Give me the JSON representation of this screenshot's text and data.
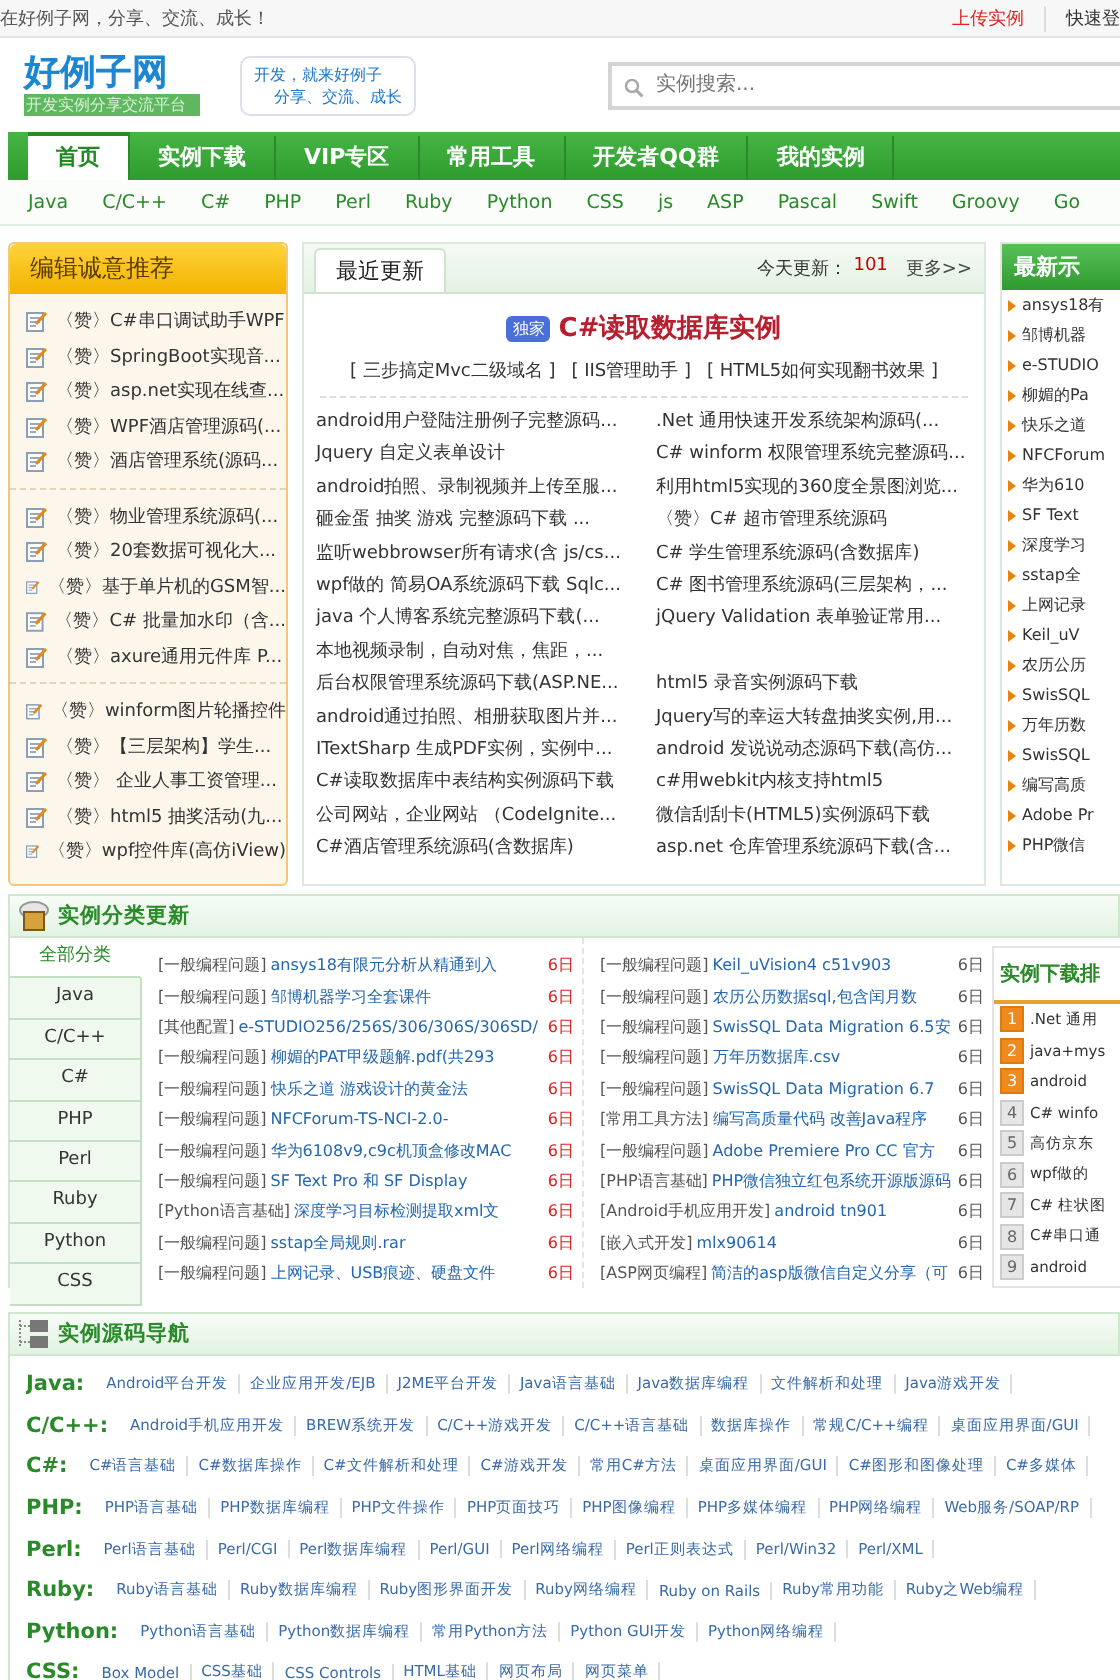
{
  "top_bar": {
    "greeting": "在好例子网，分享、交流、成长！",
    "links": [
      "上传实例",
      "快速登"
    ]
  },
  "header": {
    "logo": "好例子网",
    "logo_sub": "开发实例分享交流平台",
    "slogan": [
      "开发，就来好例子",
      "分享、交流、成长"
    ],
    "search": {
      "placeholder": "实例搜索..."
    }
  },
  "nav": [
    {
      "label": "首页",
      "selected": true
    },
    {
      "label": "实例下载",
      "selected": false
    },
    {
      "label": "VIP专区",
      "selected": false
    },
    {
      "label": "常用工具",
      "selected": false
    },
    {
      "label": "开发者QQ群",
      "selected": false
    },
    {
      "label": "我的实例",
      "selected": false
    }
  ],
  "languages": [
    "Java",
    "C/C++",
    "C#",
    "PHP",
    "Perl",
    "Ruby",
    "Python",
    "CSS",
    "js",
    "ASP",
    "Pascal",
    "Swift",
    "Groovy",
    "Go"
  ],
  "editor_picks": {
    "title": "编辑诚意推荐",
    "groups": [
      [
        "〈赞〉C#串口调试助手WPF",
        "〈赞〉SpringBoot实现音...",
        "〈赞〉asp.net实现在线查...",
        "〈赞〉WPF酒店管理源码(...",
        "〈赞〉酒店管理系统(源码..."
      ],
      [
        "〈赞〉物业管理系统源码(...",
        "〈赞〉20套数据可视化大...",
        "〈赞〉基于单片机的GSM智...",
        "〈赞〉C# 批量加水印（含...",
        "〈赞〉axure通用元件库 P..."
      ],
      [
        "〈赞〉winform图片轮播控件",
        "〈赞〉【三层架构】学生...",
        "〈赞〉 企业人事工资管理...",
        "〈赞〉html5 抽奖活动(九...",
        "〈赞〉wpf控件库(高仿iView)"
      ]
    ]
  },
  "recent": {
    "tab": "最近更新",
    "today_label": "今天更新：",
    "today_count": "101",
    "more": "更多>>",
    "featured": {
      "badge": "独家",
      "title": "C#读取数据库实例"
    },
    "quick_links": [
      "[ 三步搞定Mvc二级域名 ]",
      "[ IIS管理助手 ]",
      "[ HTML5如何实现翻书效果 ]"
    ],
    "rows": [
      {
        "left": "android用户登陆注册例子完整源码...",
        "right": ".Net 通用快速开发系统架构源码(..."
      },
      {
        "left": "Jquery 自定义表单设计",
        "right": "C# winform 权限管理系统完整源码..."
      },
      {
        "left": "android拍照、录制视频并上传至服...",
        "right": "利用html5实现的360度全景图浏览..."
      },
      {
        "left": "砸金蛋 抽奖 游戏 完整源码下载 ...",
        "right": "〈赞〉C# 超市管理系统源码"
      },
      {
        "left": "监听webbrowser所有请求(含 js/cs...",
        "right": "C# 学生管理系统源码(含数据库)"
      },
      {
        "left": "wpf做的 简易OA系统源码下载 Sqlc...",
        "right": "C# 图书管理系统源码(三层架构，..."
      },
      {
        "left": "java 个人博客系统完整源码下载(...",
        "right": "jQuery Validation 表单验证常用..."
      },
      {
        "left": "本地视频录制，自动对焦，焦距，..."
      },
      {
        "left": "后台权限管理系统源码下载(ASP.NE...",
        "right": "html5 录音实例源码下载"
      },
      {
        "left": "android通过拍照、相册获取图片并...",
        "right": "Jquery写的幸运大转盘抽奖实例,用..."
      },
      {
        "left": "ITextSharp 生成PDF实例，实例中...",
        "right": "android 发说说动态源码下载(高仿..."
      },
      {
        "left": "C#读取数据库中表结构实例源码下载",
        "right": "c#用webkit内核支持html5"
      },
      {
        "left": "公司网站，企业网站 （CodeIgnite...",
        "right": "微信刮刮卡(HTML5)实例源码下载"
      },
      {
        "left": "C#酒店管理系统源码(含数据库)",
        "right": "asp.net 仓库管理系统源码下载(含..."
      }
    ]
  },
  "latest": {
    "title": "最新示",
    "items": [
      "ansys18有",
      "邹博机器",
      "e-STUDIO",
      "柳媚的Pa",
      "快乐之道",
      "NFCForum",
      "华为610",
      "SF Text",
      "深度学习",
      "sstap全",
      "上网记录",
      "Keil_uV",
      "农历公历",
      "SwisSQL",
      "万年历数",
      "SwisSQL",
      "编写高质",
      "Adobe Pr",
      "PHP微信"
    ]
  },
  "category_updates": {
    "title": "实例分类更新",
    "categories": [
      {
        "label": "全部分类",
        "selected": true
      },
      {
        "label": "Java",
        "selected": false
      },
      {
        "label": "C/C++",
        "selected": false
      },
      {
        "label": "C#",
        "selected": false
      },
      {
        "label": "PHP",
        "selected": false
      },
      {
        "label": "Perl",
        "selected": false
      },
      {
        "label": "Ruby",
        "selected": false
      },
      {
        "label": "Python",
        "selected": false
      },
      {
        "label": "CSS",
        "selected": false
      }
    ],
    "columns": [
      [
        {
          "category": "[一般编程问题]",
          "title": "ansys18有限元分析从精通到入",
          "date": "6日",
          "recent": true
        },
        {
          "category": "[一般编程问题]",
          "title": "邹博机器学习全套课件",
          "date": "6日",
          "recent": true
        },
        {
          "category": "[其他配置]",
          "title": "e-STUDIO256/256S/306/306S/306SD/",
          "date": "6日",
          "recent": true
        },
        {
          "category": "[一般编程问题]",
          "title": "柳媚的PAT甲级题解.pdf(共293",
          "date": "6日",
          "recent": true
        },
        {
          "category": "[一般编程问题]",
          "title": "快乐之道 游戏设计的黄金法",
          "date": "6日",
          "recent": true
        },
        {
          "category": "[一般编程问题]",
          "title": "NFCForum-TS-NCI-2.0-",
          "date": "6日",
          "recent": true
        },
        {
          "category": "[一般编程问题]",
          "title": "华为6108v9,c9c机顶盒修改MAC",
          "date": "6日",
          "recent": true
        },
        {
          "category": "[一般编程问题]",
          "title": "SF Text Pro 和 SF Display",
          "date": "6日",
          "recent": true
        },
        {
          "category": "[Python语言基础]",
          "title": "深度学习目标检测提取xml文",
          "date": "6日",
          "recent": true
        },
        {
          "category": "[一般编程问题]",
          "title": "sstap全局规则.rar",
          "date": "6日",
          "recent": true
        },
        {
          "category": "[一般编程问题]",
          "title": "上网记录、USB痕迹、硬盘文件",
          "date": "6日",
          "recent": true
        }
      ],
      [
        {
          "category": "[一般编程问题]",
          "title": "Keil_uVision4 c51v903",
          "date": "6日",
          "recent": false
        },
        {
          "category": "[一般编程问题]",
          "title": "农历公历数据sql,包含闰月数",
          "date": "6日",
          "recent": false
        },
        {
          "category": "[一般编程问题]",
          "title": "SwisSQL Data Migration 6.5安",
          "date": "6日",
          "recent": false
        },
        {
          "category": "[一般编程问题]",
          "title": "万年历数据库.csv",
          "date": "6日",
          "recent": false
        },
        {
          "category": "[一般编程问题]",
          "title": "SwisSQL Data Migration 6.7",
          "date": "6日",
          "recent": false
        },
        {
          "category": "[常用工具方法]",
          "title": "编写高质量代码 改善Java程序",
          "date": "6日",
          "recent": false
        },
        {
          "category": "[一般编程问题]",
          "title": "Adobe Premiere Pro CC 官方",
          "date": "6日",
          "recent": false
        },
        {
          "category": "[PHP语言基础]",
          "title": "PHP微信独立红包系统开源版源码",
          "date": "6日",
          "recent": false
        },
        {
          "category": "[Android手机应用开发]",
          "title": "android tn901",
          "date": "6日",
          "recent": false
        },
        {
          "category": "[嵌入式开发]",
          "title": "mlx90614",
          "date": "6日",
          "recent": false
        },
        {
          "category": "[ASP网页编程]",
          "title": "简洁的asp版微信自定义分享（可",
          "date": "6日",
          "recent": false
        }
      ]
    ]
  },
  "download_ranking": {
    "title": "实例下载排",
    "items": [
      {
        "rank": "1",
        "title": ".Net 通用",
        "top": true
      },
      {
        "rank": "2",
        "title": "java+mys",
        "top": true
      },
      {
        "rank": "3",
        "title": "android",
        "top": true
      },
      {
        "rank": "4",
        "title": "C# winfo",
        "top": false
      },
      {
        "rank": "5",
        "title": "高仿京东",
        "top": false
      },
      {
        "rank": "6",
        "title": "wpf做的",
        "top": false
      },
      {
        "rank": "7",
        "title": "C# 柱状图",
        "top": false
      },
      {
        "rank": "8",
        "title": "C#串口通",
        "top": false
      },
      {
        "rank": "9",
        "title": "android",
        "top": false
      }
    ]
  },
  "source_nav": {
    "title": "实例源码导航",
    "rows": [
      {
        "language": "Java:",
        "links": [
          "Android平台开发",
          "企业应用开发/EJB",
          "J2ME平台开发",
          "Java语言基础",
          "Java数据库编程",
          "文件解析和处理",
          "Java游戏开发"
        ]
      },
      {
        "language": "C/C++:",
        "links": [
          "Android手机应用开发",
          "BREW系统开发",
          "C/C++游戏开发",
          "C/C++语言基础",
          "数据库操作",
          "常规C/C++编程",
          "桌面应用界面/GUI"
        ]
      },
      {
        "language": "C#:",
        "links": [
          "C#语言基础",
          "C#数据库操作",
          "C#文件解析和处理",
          "C#游戏开发",
          "常用C#方法",
          "桌面应用界面/GUI",
          "C#图形和图像处理",
          "C#多媒体"
        ]
      },
      {
        "language": "PHP:",
        "links": [
          "PHP语言基础",
          "PHP数据库编程",
          "PHP文件操作",
          "PHP页面技巧",
          "PHP图像编程",
          "PHP多媒体编程",
          "PHP网络编程",
          "Web服务/SOAP/RP"
        ]
      },
      {
        "language": "Perl:",
        "links": [
          "Perl语言基础",
          "Perl/CGI",
          "Perl数据库编程",
          "Perl/GUI",
          "Perl网络编程",
          "Perl正则表达式",
          "Perl/Win32",
          "Perl/XML"
        ]
      },
      {
        "language": "Ruby:",
        "links": [
          "Ruby语言基础",
          "Ruby数据库编程",
          "Ruby图形界面开发",
          "Ruby网络编程",
          "Ruby on Rails",
          "Ruby常用功能",
          "Ruby之Web编程"
        ]
      },
      {
        "language": "Python:",
        "links": [
          "Python语言基础",
          "Python数据库编程",
          "常用Python方法",
          "Python GUI开发",
          "Python网络编程"
        ]
      },
      {
        "language": "CSS:",
        "links": [
          "Box Model",
          "CSS基础",
          "CSS Controls",
          "HTML基础",
          "网页布局",
          "网页菜单"
        ]
      }
    ]
  }
}
